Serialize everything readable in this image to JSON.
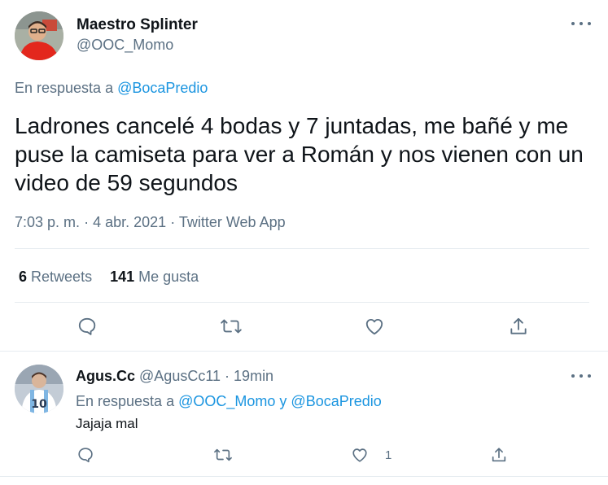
{
  "main_tweet": {
    "author_name": "Maestro Splinter",
    "author_handle": "@OOC_Momo",
    "reply_prefix": "En respuesta a",
    "reply_to": "@BocaPredio",
    "text": "Ladrones cancelé 4 bodas y 7 juntadas, me bañé y me puse la camiseta para ver a Román y nos vienen con un video de 59 segundos",
    "time": "7:03 p. m.",
    "separator": "·",
    "date": "4 abr. 2021",
    "source": "Twitter Web App",
    "retweets_count": "6",
    "retweets_label": "Retweets",
    "likes_count": "141",
    "likes_label": "Me gusta",
    "actions": [
      "reply-icon",
      "retweet-icon",
      "like-icon",
      "share-icon"
    ]
  },
  "reply_tweet": {
    "author_name": "Agus.Cc",
    "author_handle": "@AgusCc11",
    "separator": "·",
    "time_ago": "19min",
    "reply_prefix": "En respuesta a",
    "reply_to_1": "@OOC_Momo",
    "conjunction": "y",
    "reply_to_2": "@BocaPredio",
    "text": "Jajaja mal",
    "like_count": "1",
    "actions": [
      "reply-icon",
      "retweet-icon",
      "like-icon",
      "share-icon"
    ]
  },
  "colors": {
    "text_primary": "#0f1419",
    "text_secondary": "#5b7083",
    "link": "#1b95e0",
    "divider": "#e6ecf0"
  }
}
